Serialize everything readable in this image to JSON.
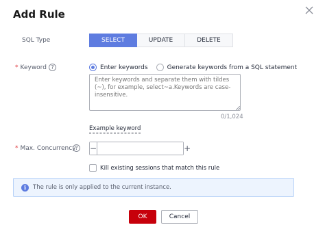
{
  "dialog": {
    "title": "Add Rule",
    "close_icon": "close-icon"
  },
  "sql_type": {
    "label": "SQL Type",
    "options": [
      "SELECT",
      "UPDATE",
      "DELETE"
    ],
    "selected": "SELECT",
    "accent_color": "#5e7ce0"
  },
  "keyword": {
    "label": "Keyword",
    "required": "*",
    "help_icon": "question-circle-icon",
    "radio_options": [
      "Enter keywords",
      "Generate keywords from a SQL statement"
    ],
    "selected": "Enter keywords",
    "placeholder": "Enter keywords and separate them with tildes (~), for example, select~a.Keywords are case-insensitive.",
    "value": "",
    "counter": "0/1,024",
    "example_link": "Example keyword"
  },
  "concurrency": {
    "label": "Max. Concurrency",
    "required": "*",
    "help_icon": "question-circle-icon",
    "value": "",
    "minus": "−",
    "plus": "+"
  },
  "kill_sessions": {
    "label": "Kill existing sessions that match this rule",
    "checked": false
  },
  "info": {
    "icon": "info-icon",
    "text": "The rule is only applied to the current instance."
  },
  "footer": {
    "ok_label": "OK",
    "cancel_label": "Cancel",
    "ok_color": "#c7000b"
  }
}
